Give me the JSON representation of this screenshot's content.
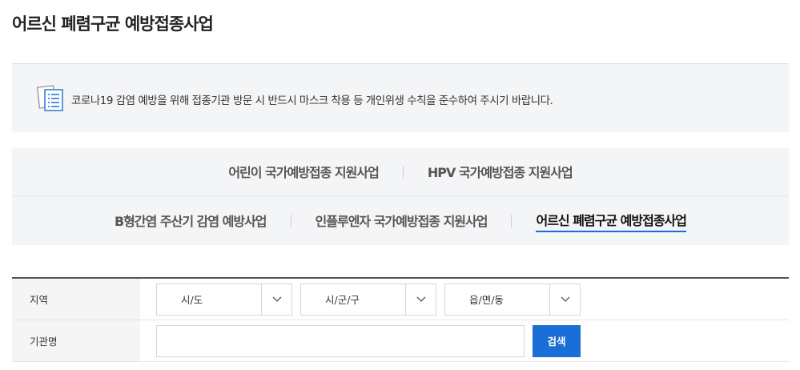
{
  "page": {
    "title": "어르신 폐렴구균 예방접종사업"
  },
  "notice": {
    "icon": "document-list-icon",
    "text": "코로나19 감염 예방을 위해 접종기관 방문 시 반드시 마스크 착용 등 개인위생 수칙을 준수하여 주시기 바랍니다."
  },
  "tabs": {
    "row1": [
      {
        "label": "어린이 국가예방접종 지원사업"
      },
      {
        "label": "HPV 국가예방접종 지원사업"
      }
    ],
    "row2": [
      {
        "label": "B형간염 주산기 감염 예방사업"
      },
      {
        "label": "인플루엔자 국가예방접종 지원사업"
      },
      {
        "label": "어르신 폐렴구균 예방접종사업"
      }
    ],
    "active": "어르신 폐렴구균 예방접종사업"
  },
  "form": {
    "region_label": "지역",
    "selects": {
      "sido": "시/도",
      "sigungu": "시/군/구",
      "eupmyeondong": "읍/면/동"
    },
    "institution_label": "기관명",
    "institution_value": "",
    "search_label": "검색"
  },
  "colors": {
    "accent": "#1a6fd6",
    "panel": "#f4f5f7"
  }
}
